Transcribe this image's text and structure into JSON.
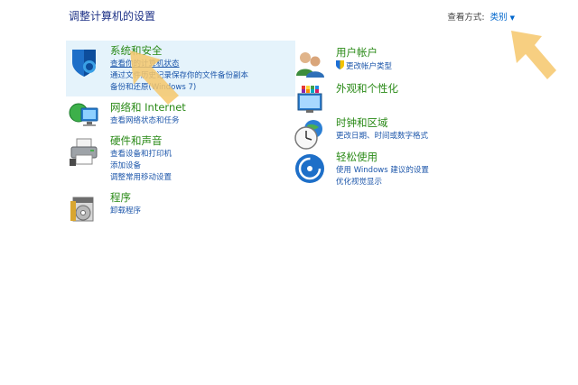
{
  "page": {
    "title": "调整计算机的设置",
    "view_by_label": "查看方式:",
    "view_by_value": "类别"
  },
  "categories_left": [
    {
      "title": "系统和安全",
      "icon": "shield-icon",
      "links": [
        "查看你的计算机状态",
        "通过文件历史记录保存你的文件备份副本",
        "备份和还原(Windows 7)"
      ]
    },
    {
      "title": "网络和 Internet",
      "icon": "network-globe-icon",
      "links": [
        "查看网络状态和任务"
      ]
    },
    {
      "title": "硬件和声音",
      "icon": "printer-icon",
      "links": [
        "查看设备和打印机",
        "添加设备",
        "调整常用移动设置"
      ]
    },
    {
      "title": "程序",
      "icon": "programs-disc-icon",
      "links": [
        "卸载程序"
      ]
    }
  ],
  "categories_right": [
    {
      "title": "用户帐户",
      "icon": "users-icon",
      "links": [
        "更改帐户类型"
      ]
    },
    {
      "title": "外观和个性化",
      "icon": "monitor-palette-icon",
      "links": []
    },
    {
      "title": "时钟和区域",
      "icon": "clock-globe-icon",
      "links": [
        "更改日期、时间或数字格式"
      ]
    },
    {
      "title": "轻松使用",
      "icon": "ease-of-access-icon",
      "links": [
        "使用 Windows 建议的设置",
        "优化视觉显示"
      ]
    }
  ],
  "colors": {
    "title": "#1e3287",
    "category_title": "#2a8a17",
    "link": "#1c56aa",
    "selection": "#e5f3fb",
    "annotation_arrow": "#f6c76b"
  }
}
